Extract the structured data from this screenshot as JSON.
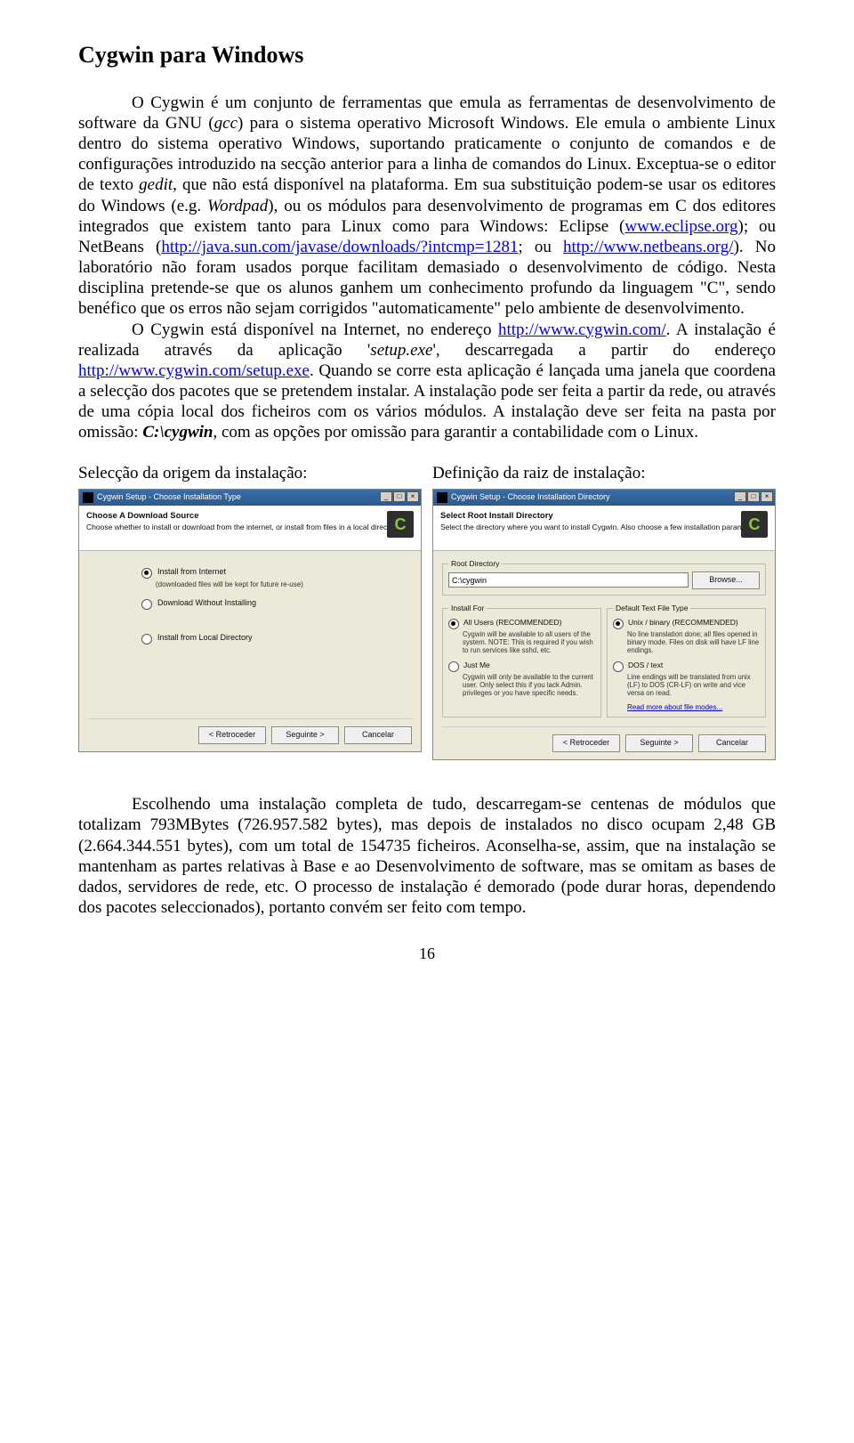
{
  "title": "Cygwin para Windows",
  "p1_a": "O Cygwin é um conjunto de ferramentas que emula as ferramentas de desenvolvimento de software da GNU (",
  "p1_gcc": "gcc",
  "p1_b": ") para o sistema operativo Microsoft Windows. Ele emula o ambiente Linux dentro do sistema operativo Windows, suportando praticamente o conjunto de comandos e de configurações introduzido na secção anterior para a linha de comandos do Linux. Exceptua-se o editor de texto ",
  "p1_gedit": "gedit",
  "p1_c": ", que não está disponível na plataforma. Em sua substituição podem-se usar os editores do Windows (e.g. ",
  "p1_wordpad": "Wordpad",
  "p1_d": "), ou os módulos para desenvolvimento de programas em C dos editores integrados que existem tanto para Linux como para Windows: Eclipse (",
  "p1_link1": "www.eclipse.org",
  "p1_e": "); ou NetBeans (",
  "p1_link2": "http://java.sun.com/javase/downloads/?intcmp=1281",
  "p1_f": "; ou ",
  "p1_link3": "http://www.netbeans.org/",
  "p1_g": "). No laboratório não foram usados porque facilitam demasiado o desenvolvimento de código. Nesta disciplina pretende-se que os alunos ganhem um conhecimento profundo da linguagem \"C\", sendo benéfico que os erros não sejam corrigidos \"automaticamente\" pelo ambiente de desenvolvimento.",
  "p2_a": "O Cygwin está disponível na Internet, no endereço ",
  "p2_link1": "http://www.cygwin.com/",
  "p2_b": ". A instalação é realizada através da aplicação '",
  "p2_setup": "setup.exe",
  "p2_c": "', descarregada a partir do endereço ",
  "p2_link2": "http://www.cygwin.com/setup.exe",
  "p2_d": ". Quando se corre esta aplicação é lançada uma janela que coordena a selecção dos pacotes que se pretendem instalar. A instalação pode ser feita a partir da rede, ou através de uma cópia local dos ficheiros com os vários módulos. A instalação deve ser feita na pasta por omissão: ",
  "p2_path": "C:\\cygwin",
  "p2_e": ", com as opções por omissão para garantir a contabilidade com o Linux.",
  "cap_left": "Selecção da origem da instalação:",
  "cap_right": "Definição da raiz de instalação:",
  "dlg1": {
    "title": "Cygwin Setup - Choose Installation Type",
    "h1": "Choose A Download Source",
    "h2": "Choose whether to install or download from the internet, or install from files in a local directory.",
    "opt1": "Install from Internet",
    "opt1_sub": "(downloaded files will be kept for future re-use)",
    "opt2": "Download Without Installing",
    "opt3": "Install from Local Directory",
    "back": "< Retroceder",
    "next": "Seguinte >",
    "cancel": "Cancelar"
  },
  "dlg2": {
    "title": "Cygwin Setup - Choose Installation Directory",
    "h1": "Select Root Install Directory",
    "h2": "Select the directory where you want to install Cygwin. Also choose a few installation parameters.",
    "root_label": "Root Directory",
    "root_value": "C:\\cygwin",
    "browse": "Browse...",
    "installfor_label": "Install For",
    "filetype_label": "Default Text File Type",
    "allusers": "All Users (RECOMMENDED)",
    "allusers_desc": "Cygwin will be available to all users of the system. NOTE: This is required if you wish to run services like sshd, etc.",
    "justme": "Just Me",
    "justme_desc": "Cygwin will only be available to the current user. Only select this if you lack Admin. privileges or you have specific needs.",
    "unix": "Unix / binary (RECOMMENDED)",
    "unix_desc": "No line translation done; all files opened in binary mode. Files on disk will have LF line endings.",
    "dos": "DOS / text",
    "dos_desc": "Line endings will be translated from unix (LF) to DOS (CR-LF) on write and vice versa on read.",
    "more": "Read more about file modes...",
    "back": "< Retroceder",
    "next": "Seguinte >",
    "cancel": "Cancelar"
  },
  "p3": "Escolhendo uma instalação completa de tudo, descarregam-se centenas de módulos que totalizam 793MBytes (726.957.582 bytes), mas depois de instalados no disco ocupam 2,48 GB (2.664.344.551 bytes), com um total de 154735 ficheiros. Aconselha-se, assim, que na instalação se mantenham as partes relativas à Base e ao Desenvolvimento de software, mas se omitam as bases de dados, servidores de rede, etc. O processo de instalação é demorado (pode durar horas, dependendo dos pacotes seleccionados), portanto convém ser feito com tempo.",
  "pagenum": "16"
}
